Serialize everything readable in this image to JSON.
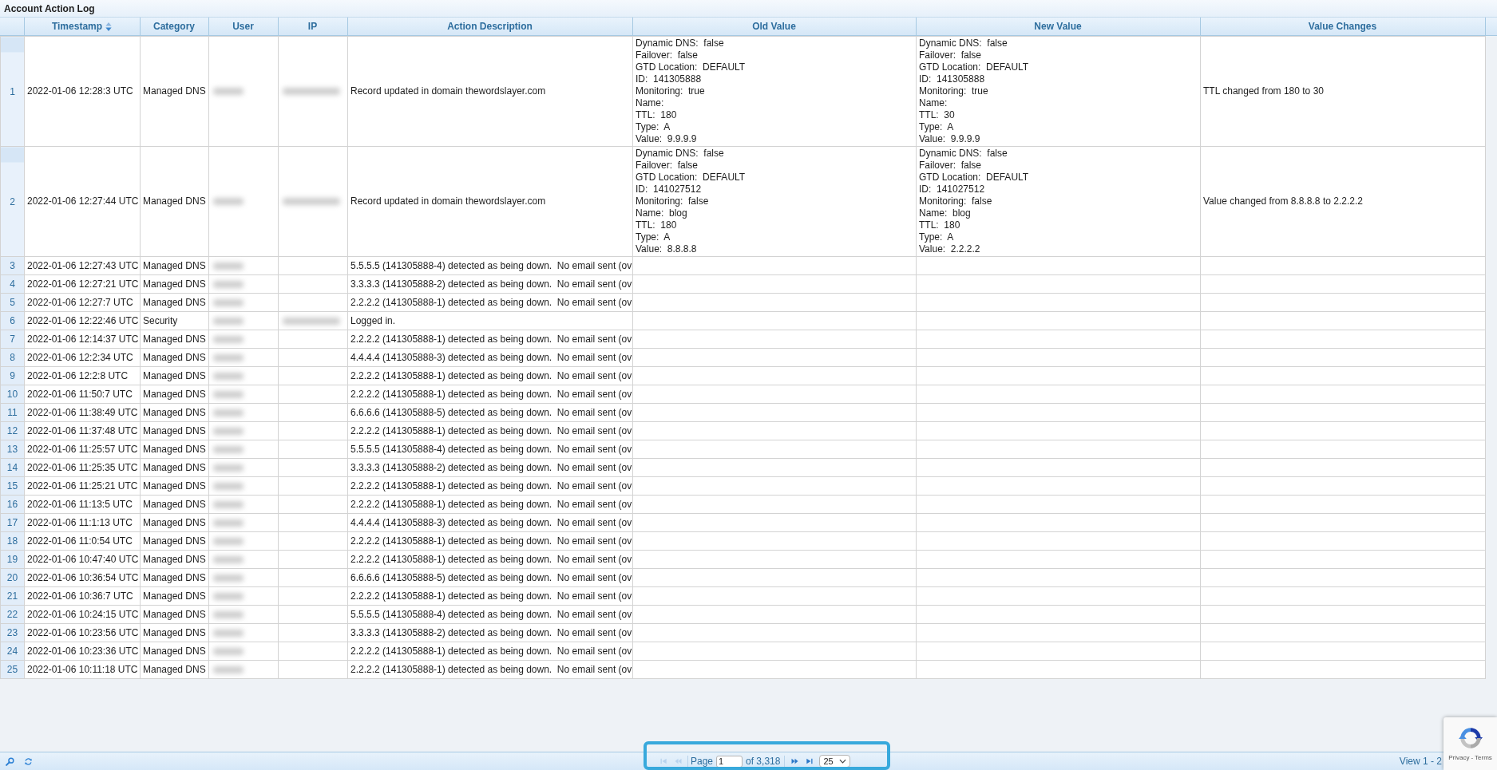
{
  "title": "Account Action Log",
  "table": {
    "columns": [
      {
        "label": "Timestamp",
        "sorted": true
      },
      {
        "label": "Category",
        "sorted": false
      },
      {
        "label": "User",
        "sorted": false
      },
      {
        "label": "IP",
        "sorted": false
      },
      {
        "label": "Action Description",
        "sorted": false
      },
      {
        "label": "Old Value",
        "sorted": false
      },
      {
        "label": "New Value",
        "sorted": false
      },
      {
        "label": "Value Changes",
        "sorted": false
      }
    ],
    "rows": [
      {
        "number": "1",
        "timestamp": "2022-01-06 12:28:3 UTC",
        "category": "Managed DNS",
        "user_blurred": true,
        "ip_blurred": true,
        "action": "Record updated in domain thewordslayer.com",
        "old_value": [
          "Dynamic DNS:  false",
          "Failover:  false",
          "GTD Location:  DEFAULT",
          "ID:  141305888",
          "Monitoring:  true",
          "Name:",
          "TTL:  180",
          "Type:  A",
          "Value:  9.9.9.9"
        ],
        "new_value": [
          "Dynamic DNS:  false",
          "Failover:  false",
          "GTD Location:  DEFAULT",
          "ID:  141305888",
          "Monitoring:  true",
          "Name:",
          "TTL:  30",
          "Type:  A",
          "Value:  9.9.9.9"
        ],
        "value_changes": "TTL changed from 180 to 30"
      },
      {
        "number": "2",
        "timestamp": "2022-01-06 12:27:44 UTC",
        "category": "Managed DNS",
        "user_blurred": true,
        "ip_blurred": true,
        "action": "Record updated in domain thewordslayer.com",
        "old_value": [
          "Dynamic DNS:  false",
          "Failover:  false",
          "GTD Location:  DEFAULT",
          "ID:  141027512",
          "Monitoring:  false",
          "Name:  blog",
          "TTL:  180",
          "Type:  A",
          "Value:  8.8.8.8"
        ],
        "new_value": [
          "Dynamic DNS:  false",
          "Failover:  false",
          "GTD Location:  DEFAULT",
          "ID:  141027512",
          "Monitoring:  false",
          "Name:  blog",
          "TTL:  180",
          "Type:  A",
          "Value:  2.2.2.2"
        ],
        "value_changes": "Value changed from 8.8.8.8 to 2.2.2.2"
      },
      {
        "number": "3",
        "timestamp": "2022-01-06 12:27:43 UTC",
        "category": "Managed DNS",
        "user_blurred": true,
        "ip_blurred": false,
        "action": "5.5.5.5 (141305888-4) detected as being down.  No email sent (ov"
      },
      {
        "number": "4",
        "timestamp": "2022-01-06 12:27:21 UTC",
        "category": "Managed DNS",
        "user_blurred": true,
        "ip_blurred": false,
        "action": "3.3.3.3 (141305888-2) detected as being down.  No email sent (ov"
      },
      {
        "number": "5",
        "timestamp": "2022-01-06 12:27:7 UTC",
        "category": "Managed DNS",
        "user_blurred": true,
        "ip_blurred": false,
        "action": "2.2.2.2 (141305888-1) detected as being down.  No email sent (ov"
      },
      {
        "number": "6",
        "timestamp": "2022-01-06 12:22:46 UTC",
        "category": "Security",
        "user_blurred": true,
        "ip_blurred": true,
        "action": "Logged in."
      },
      {
        "number": "7",
        "timestamp": "2022-01-06 12:14:37 UTC",
        "category": "Managed DNS",
        "user_blurred": true,
        "ip_blurred": false,
        "action": "2.2.2.2 (141305888-1) detected as being down.  No email sent (ov"
      },
      {
        "number": "8",
        "timestamp": "2022-01-06 12:2:34 UTC",
        "category": "Managed DNS",
        "user_blurred": true,
        "ip_blurred": false,
        "action": "4.4.4.4 (141305888-3) detected as being down.  No email sent (ov"
      },
      {
        "number": "9",
        "timestamp": "2022-01-06 12:2:8 UTC",
        "category": "Managed DNS",
        "user_blurred": true,
        "ip_blurred": false,
        "action": "2.2.2.2 (141305888-1) detected as being down.  No email sent (ov"
      },
      {
        "number": "10",
        "timestamp": "2022-01-06 11:50:7 UTC",
        "category": "Managed DNS",
        "user_blurred": true,
        "ip_blurred": false,
        "action": "2.2.2.2 (141305888-1) detected as being down.  No email sent (ov"
      },
      {
        "number": "11",
        "timestamp": "2022-01-06 11:38:49 UTC",
        "category": "Managed DNS",
        "user_blurred": true,
        "ip_blurred": false,
        "action": "6.6.6.6 (141305888-5) detected as being down.  No email sent (ov"
      },
      {
        "number": "12",
        "timestamp": "2022-01-06 11:37:48 UTC",
        "category": "Managed DNS",
        "user_blurred": true,
        "ip_blurred": false,
        "action": "2.2.2.2 (141305888-1) detected as being down.  No email sent (ov"
      },
      {
        "number": "13",
        "timestamp": "2022-01-06 11:25:57 UTC",
        "category": "Managed DNS",
        "user_blurred": true,
        "ip_blurred": false,
        "action": "5.5.5.5 (141305888-4) detected as being down.  No email sent (ov"
      },
      {
        "number": "14",
        "timestamp": "2022-01-06 11:25:35 UTC",
        "category": "Managed DNS",
        "user_blurred": true,
        "ip_blurred": false,
        "action": "3.3.3.3 (141305888-2) detected as being down.  No email sent (ov"
      },
      {
        "number": "15",
        "timestamp": "2022-01-06 11:25:21 UTC",
        "category": "Managed DNS",
        "user_blurred": true,
        "ip_blurred": false,
        "action": "2.2.2.2 (141305888-1) detected as being down.  No email sent (ov"
      },
      {
        "number": "16",
        "timestamp": "2022-01-06 11:13:5 UTC",
        "category": "Managed DNS",
        "user_blurred": true,
        "ip_blurred": false,
        "action": "2.2.2.2 (141305888-1) detected as being down.  No email sent (ov"
      },
      {
        "number": "17",
        "timestamp": "2022-01-06 11:1:13 UTC",
        "category": "Managed DNS",
        "user_blurred": true,
        "ip_blurred": false,
        "action": "4.4.4.4 (141305888-3) detected as being down.  No email sent (ov"
      },
      {
        "number": "18",
        "timestamp": "2022-01-06 11:0:54 UTC",
        "category": "Managed DNS",
        "user_blurred": true,
        "ip_blurred": false,
        "action": "2.2.2.2 (141305888-1) detected as being down.  No email sent (ov"
      },
      {
        "number": "19",
        "timestamp": "2022-01-06 10:47:40 UTC",
        "category": "Managed DNS",
        "user_blurred": true,
        "ip_blurred": false,
        "action": "2.2.2.2 (141305888-1) detected as being down.  No email sent (ov"
      },
      {
        "number": "20",
        "timestamp": "2022-01-06 10:36:54 UTC",
        "category": "Managed DNS",
        "user_blurred": true,
        "ip_blurred": false,
        "action": "6.6.6.6 (141305888-5) detected as being down.  No email sent (ov"
      },
      {
        "number": "21",
        "timestamp": "2022-01-06 10:36:7 UTC",
        "category": "Managed DNS",
        "user_blurred": true,
        "ip_blurred": false,
        "action": "2.2.2.2 (141305888-1) detected as being down.  No email sent (ov"
      },
      {
        "number": "22",
        "timestamp": "2022-01-06 10:24:15 UTC",
        "category": "Managed DNS",
        "user_blurred": true,
        "ip_blurred": false,
        "action": "5.5.5.5 (141305888-4) detected as being down.  No email sent (ov"
      },
      {
        "number": "23",
        "timestamp": "2022-01-06 10:23:56 UTC",
        "category": "Managed DNS",
        "user_blurred": true,
        "ip_blurred": false,
        "action": "3.3.3.3 (141305888-2) detected as being down.  No email sent (ov"
      },
      {
        "number": "24",
        "timestamp": "2022-01-06 10:23:36 UTC",
        "category": "Managed DNS",
        "user_blurred": true,
        "ip_blurred": false,
        "action": "2.2.2.2 (141305888-1) detected as being down.  No email sent (ov"
      },
      {
        "number": "25",
        "timestamp": "2022-01-06 10:11:18 UTC",
        "category": "Managed DNS",
        "user_blurred": true,
        "ip_blurred": false,
        "action": "2.2.2.2 (141305888-1) detected as being down.  No email sent (ov"
      }
    ]
  },
  "footer": {
    "nav": [
      {
        "kind": "first",
        "disabled": true
      },
      {
        "kind": "prev",
        "disabled": true
      },
      {
        "kind": "next",
        "disabled": false
      },
      {
        "kind": "last",
        "disabled": false
      }
    ],
    "page_label": "Page",
    "page_input": "1",
    "page_total": "of 3,318",
    "page_size": "25",
    "view_text": "View 1 - 2"
  },
  "captcha": {
    "privacy_link": "Privacy",
    "separator": "-",
    "terms_link": "Terms"
  }
}
